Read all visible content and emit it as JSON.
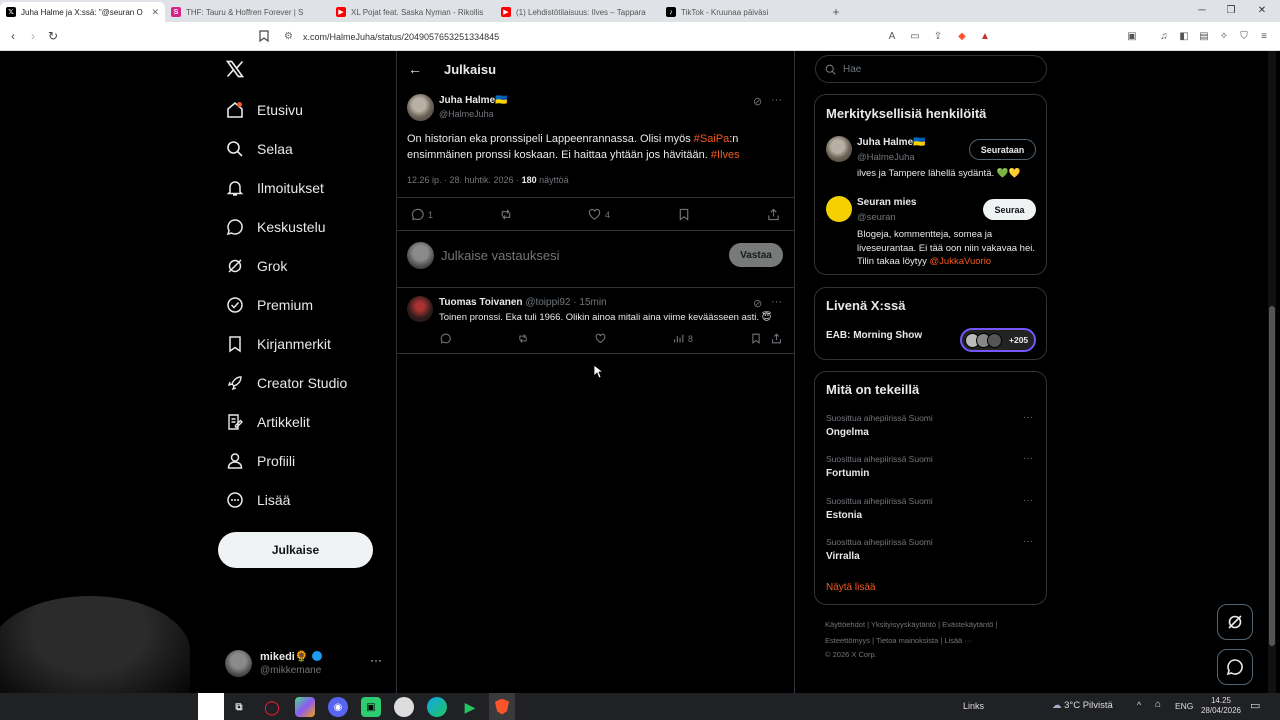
{
  "browser": {
    "tabs": [
      {
        "title": "Juha Halme ja X:ssä: \"@seuran O",
        "active": true,
        "favicon": "x-icon",
        "color": "#000000"
      },
      {
        "title": "THF: Tauru & Hoffren Forever | S",
        "active": false,
        "favicon": "podcast-icon",
        "color": "#d6248b"
      },
      {
        "title": "XL Pojat feat. Saska Nyman - Rikollis",
        "active": false,
        "favicon": "youtube-icon",
        "color": "#ff0000"
      },
      {
        "title": "(1) Lehdistötilaisuus: Ilves – Tappara",
        "active": false,
        "favicon": "youtube-icon",
        "color": "#ff0000"
      },
      {
        "title": "TikTok - Kruunaa päiväsi",
        "active": false,
        "favicon": "tiktok-icon",
        "color": "#000000"
      }
    ],
    "url": "x.com/HalmeJuha/status/2049057653251334845"
  },
  "nav": {
    "items": [
      {
        "label": "Etusivu",
        "icon": "home-icon"
      },
      {
        "label": "Selaa",
        "icon": "search-icon"
      },
      {
        "label": "Ilmoitukset",
        "icon": "bell-icon"
      },
      {
        "label": "Keskustelu",
        "icon": "chat-icon"
      },
      {
        "label": "Grok",
        "icon": "grok-icon"
      },
      {
        "label": "Premium",
        "icon": "verified-icon"
      },
      {
        "label": "Kirjanmerkit",
        "icon": "bookmark-icon"
      },
      {
        "label": "Creator Studio",
        "icon": "rocket-icon"
      },
      {
        "label": "Artikkelit",
        "icon": "article-icon"
      },
      {
        "label": "Profiili",
        "icon": "person-icon"
      },
      {
        "label": "Lisää",
        "icon": "more-icon"
      }
    ],
    "post_button": "Julkaise",
    "account": {
      "name": "mikedi🌻",
      "handle": "@mikkemane"
    }
  },
  "main": {
    "header": "Julkaisu",
    "post": {
      "author": "Juha Halme🇺🇦",
      "handle": "@HalmeJuha",
      "text_1": "On historian eka pronssipeli Lappeenrannassa. Olisi myös ",
      "tag_1": "#SaiPa",
      "text_2": ":n ensimmäinen pronssi koskaan. Ei haittaa yhtään jos hävitään. ",
      "tag_2": "#Ilves",
      "time": "12.26 ip. · 28. huhtik. 2026 · ",
      "views": "180",
      "views_label": " näyttöä",
      "replies": "1",
      "likes": "4"
    },
    "reply_box": {
      "placeholder": "Julkaise vastauksesi",
      "button": "Vastaa"
    },
    "reply": {
      "author": "Tuomas Toivanen",
      "handle": "@toippi92",
      "time": " · 15min",
      "text": "Toinen pronssi. Eka tuli 1966. Olikin ainoa mitali aina viime keväässeen asti. 😇",
      "views": "8"
    }
  },
  "right": {
    "search_placeholder": "Hae",
    "relevant_title": "Merkityksellisiä henkilöitä",
    "people": [
      {
        "name": "Juha Halme🇺🇦",
        "handle": "@HalmeJuha",
        "button": "Seurataan",
        "bio": "ilves ja Tampere lähellä sydäntä. 💚💛"
      },
      {
        "name": "Seuran mies",
        "handle": "@seuran",
        "button": "Seuraa",
        "bio": "Blogeja, kommentteja, somea ja liveseurantaa. Ei tää oon niin vakavaa hei. Tilin takaa löytyy ",
        "bio_link": "@JukkaVuorio"
      }
    ],
    "live_title": "Livenä X:ssä",
    "live": {
      "title": "EAB: Morning Show",
      "count": "+205"
    },
    "trends_title": "Mitä on tekeillä",
    "trends": [
      {
        "context": "Suosittua aihepiirissä Suomi",
        "topic": "Ongelma"
      },
      {
        "context": "Suosittua aihepiirissä Suomi",
        "topic": "Fortumin"
      },
      {
        "context": "Suosittua aihepiirissä Suomi",
        "topic": "Estonia"
      },
      {
        "context": "Suosittua aihepiirissä Suomi",
        "topic": "Virralla"
      }
    ],
    "show_more": "Näytä lisää",
    "footer": {
      "links_1": [
        "Käyttöehdot",
        "Yksityisyyskäytäntö",
        "Evästekäytäntö"
      ],
      "links_2": [
        "Esteettömyys",
        "Tietoa mainoksista",
        "Lisää ···"
      ],
      "copyright": "© 2026 X Corp."
    }
  },
  "taskbar": {
    "links": "Links",
    "weather": "3°C  Pilvistä",
    "lang": "ENG",
    "time": "14.25",
    "date": "28/04/2026"
  },
  "colors": {
    "accent": "#f4591f",
    "background": "#000000",
    "border": "#2f3336"
  }
}
